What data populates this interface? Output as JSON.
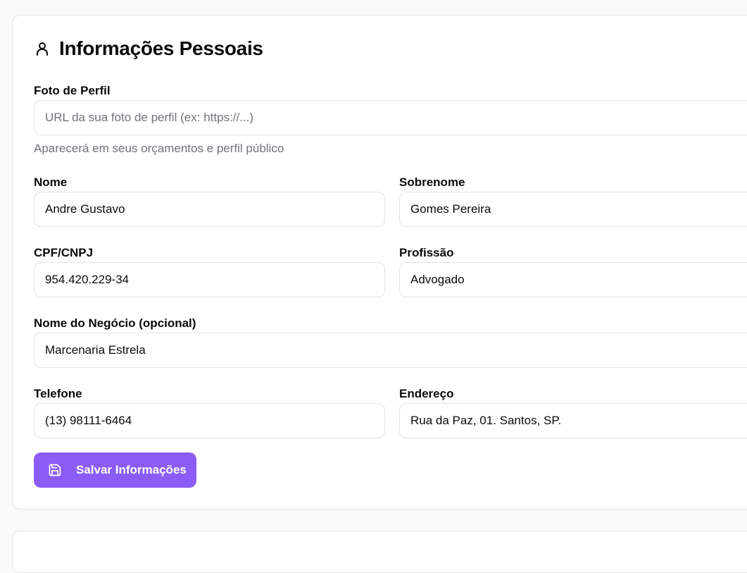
{
  "section": {
    "title": "Informações Pessoais",
    "icon": "user-icon"
  },
  "fields": {
    "photo": {
      "label": "Foto de Perfil",
      "value": "",
      "placeholder": "URL da sua foto de perfil (ex: https://...)",
      "helper": "Aparecerá em seus orçamentos e perfil público"
    },
    "first_name": {
      "label": "Nome",
      "value": "Andre Gustavo"
    },
    "last_name": {
      "label": "Sobrenome",
      "value": "Gomes Pereira"
    },
    "document": {
      "label": "CPF/CNPJ",
      "value": "954.420.229-34"
    },
    "profession": {
      "label": "Profissão",
      "value": "Advogado"
    },
    "business_name": {
      "label": "Nome do Negócio (opcional)",
      "value": "Marcenaria Estrela"
    },
    "phone": {
      "label": "Telefone",
      "value": "(13) 98111-6464"
    },
    "address": {
      "label": "Endereço",
      "value": "Rua da Paz, 01. Santos, SP."
    }
  },
  "save_button": {
    "label": "Salvar Informações",
    "icon": "save-icon"
  },
  "colors": {
    "accent": "#8b5cf6",
    "border": "#e4e4e7",
    "muted_text": "#71717a"
  }
}
